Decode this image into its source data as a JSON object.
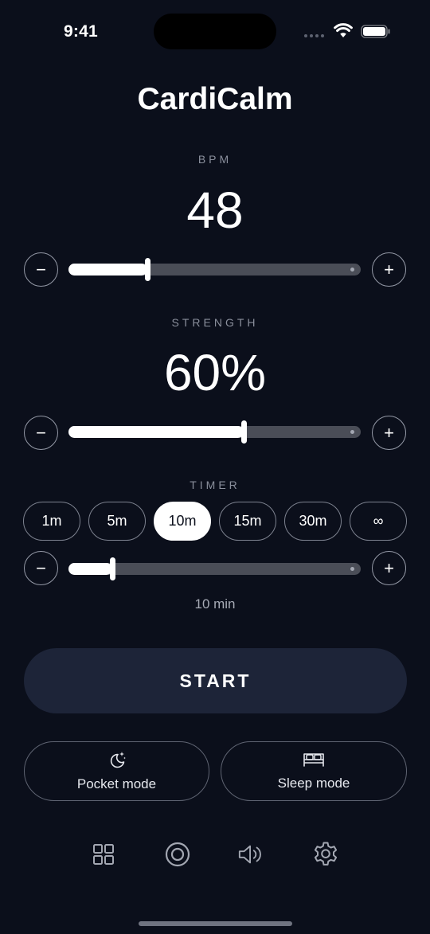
{
  "status_bar": {
    "time": "9:41"
  },
  "app": {
    "title": "CardiCalm"
  },
  "bpm": {
    "label": "BPM",
    "value": "48",
    "slider_fraction": 0.27,
    "minus_label": "−",
    "plus_label": "+"
  },
  "strength": {
    "label": "STRENGTH",
    "value": "60%",
    "slider_fraction": 0.6,
    "minus_label": "−",
    "plus_label": "+"
  },
  "timer": {
    "label": "TIMER",
    "options": [
      "1m",
      "5m",
      "10m",
      "15m",
      "30m",
      "∞"
    ],
    "selected": "10m",
    "slider_fraction": 0.15,
    "caption": "10 min",
    "minus_label": "−",
    "plus_label": "+"
  },
  "start_button": {
    "label": "START"
  },
  "modes": {
    "pocket": {
      "label": "Pocket mode",
      "icon": "moon-stars-icon"
    },
    "sleep": {
      "label": "Sleep mode",
      "icon": "bed-icon"
    }
  },
  "bottom_nav": [
    {
      "icon": "grid-icon"
    },
    {
      "icon": "target-icon"
    },
    {
      "icon": "speaker-icon"
    },
    {
      "icon": "gear-icon"
    }
  ],
  "colors": {
    "background": "#0b0f1b",
    "start_button": "#1d2438",
    "track": "#4a4d57",
    "accent": "#ffffff"
  }
}
